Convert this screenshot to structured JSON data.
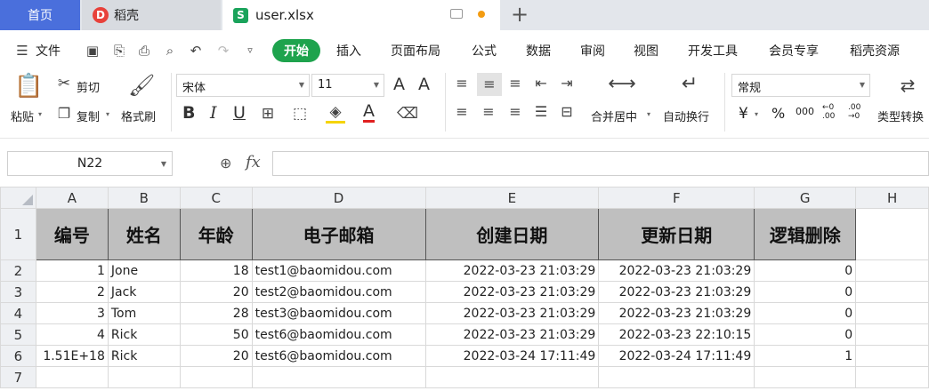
{
  "tabs": {
    "home": "首页",
    "daoke": "稻壳",
    "daoke_logo": "D",
    "file": "user.xlsx",
    "file_logo": "S",
    "plus": "+"
  },
  "menu": {
    "file_label": "文件",
    "start": "开始",
    "items": [
      "插入",
      "页面布局",
      "公式",
      "数据",
      "审阅",
      "视图",
      "开发工具",
      "会员专享",
      "稻壳资源"
    ]
  },
  "ribbon": {
    "paste": "粘贴",
    "cut": "剪切",
    "copy": "复制",
    "format_painter": "格式刷",
    "font_name": "宋体",
    "font_size": "11",
    "merge_center": "合并居中",
    "wrap_text": "自动换行",
    "number_format": "常规",
    "type_convert": "类型转换",
    "bold": "B",
    "italic": "I",
    "underline": "U",
    "font_color_letter": "A",
    "grow_letter": "A",
    "shrink_letter": "A",
    "currency": "¥",
    "percent": "%",
    "thousands": "000",
    "inc_decimal": "←0 .00",
    "dec_decimal": ".00 →0"
  },
  "formula_bar": {
    "cell_ref": "N22",
    "fx": "fx",
    "value": ""
  },
  "sheet": {
    "columns": [
      "A",
      "B",
      "C",
      "D",
      "E",
      "F",
      "G",
      "H"
    ],
    "row_numbers": [
      "1",
      "2",
      "3",
      "4",
      "5",
      "6",
      "7"
    ],
    "headers": [
      "编号",
      "姓名",
      "年龄",
      "电子邮箱",
      "创建日期",
      "更新日期",
      "逻辑删除"
    ],
    "rows": [
      [
        "1",
        "Jone",
        "18",
        "test1@baomidou.com",
        "2022-03-23 21:03:29",
        "2022-03-23 21:03:29",
        "0"
      ],
      [
        "2",
        "Jack",
        "20",
        "test2@baomidou.com",
        "2022-03-23 21:03:29",
        "2022-03-23 21:03:29",
        "0"
      ],
      [
        "3",
        "Tom",
        "28",
        "test3@baomidou.com",
        "2022-03-23 21:03:29",
        "2022-03-23 21:03:29",
        "0"
      ],
      [
        "4",
        "Rick",
        "50",
        "test6@baomidou.com",
        "2022-03-23 21:03:29",
        "2022-03-23 22:10:15",
        "0"
      ],
      [
        "1.51E+18",
        "Rick",
        "20",
        "test6@baomidou.com",
        "2022-03-24 17:11:49",
        "2022-03-24 17:11:49",
        "1"
      ]
    ]
  }
}
